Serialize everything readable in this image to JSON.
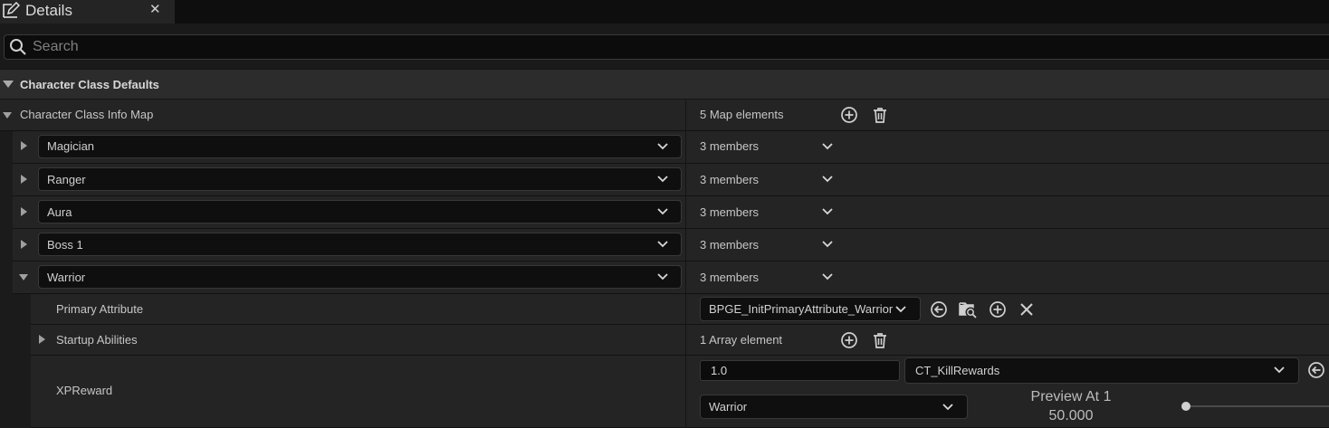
{
  "tab": {
    "title": "Details",
    "close": "✕"
  },
  "search": {
    "placeholder": "Search"
  },
  "category": {
    "label": "Character Class Defaults"
  },
  "map": {
    "label": "Character Class Info Map",
    "count": "5 Map elements"
  },
  "entries": [
    {
      "key": "Magician",
      "value": "3 members",
      "expanded": false
    },
    {
      "key": "Ranger",
      "value": "3 members",
      "expanded": false
    },
    {
      "key": "Aura",
      "value": "3 members",
      "expanded": false
    },
    {
      "key": "Boss 1",
      "value": "3 members",
      "expanded": false
    },
    {
      "key": "Warrior",
      "value": "3 members",
      "expanded": true
    }
  ],
  "warrior": {
    "primary_attribute": {
      "label": "Primary Attribute",
      "value": "BPGE_InitPrimaryAttribute_Warrior"
    },
    "startup_abilities": {
      "label": "Startup Abilities",
      "count": "1 Array element"
    },
    "xp_reward": {
      "label": "XPReward",
      "value": "1.0",
      "curve_table": "CT_KillRewards",
      "row_name": "Warrior",
      "preview_label": "Preview At 1",
      "preview_value": "50.000"
    }
  },
  "colors": {
    "background": "#151515",
    "row": "#242424",
    "field": "#0f0f0f",
    "text": "#c6c6c6"
  }
}
